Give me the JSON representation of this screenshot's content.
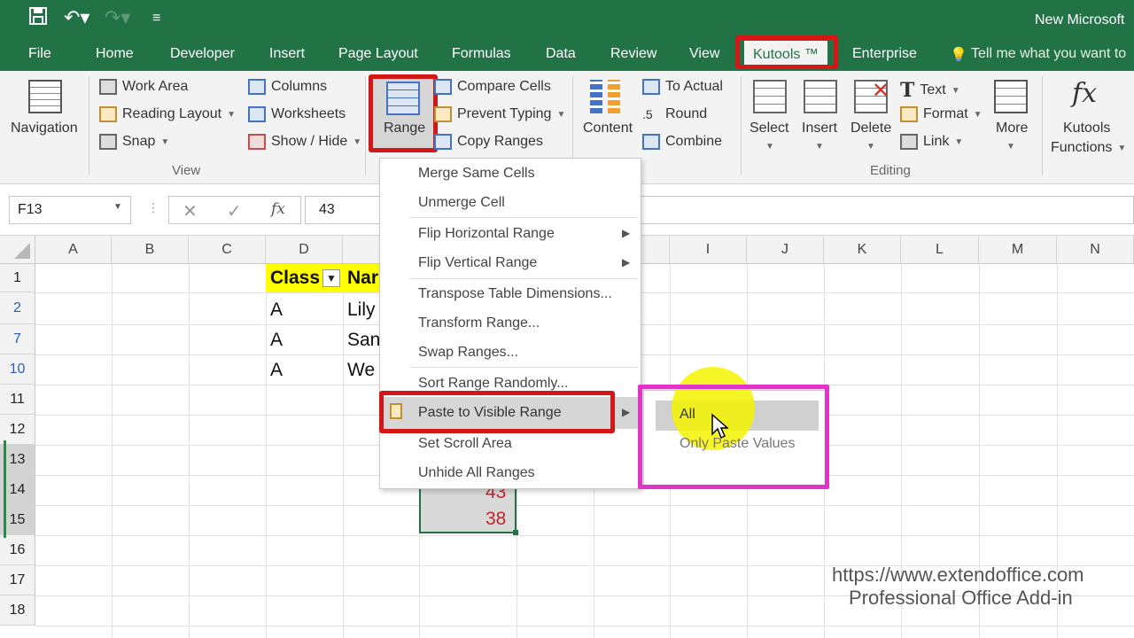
{
  "window": {
    "title": "New Microsoft"
  },
  "tabs": [
    "File",
    "Home",
    "Developer",
    "Insert",
    "Page Layout",
    "Formulas",
    "Data",
    "Review",
    "View",
    "Kutools ™",
    "Enterprise",
    "Tell me what you want to"
  ],
  "ribbon": {
    "navigation": "Navigation",
    "view_group": {
      "items": [
        "Work Area",
        "Reading Layout",
        "Snap",
        "Columns",
        "Worksheets",
        "Show / Hide"
      ],
      "label": "View"
    },
    "range": "Range",
    "range_items": [
      "Compare Cells",
      "Prevent Typing",
      "Copy Ranges"
    ],
    "content": "Content",
    "content_items": [
      "To Actual",
      "Round",
      "Combine"
    ],
    "editing": {
      "select": "Select",
      "insert": "Insert",
      "delete": "Delete",
      "text": "Text",
      "format": "Format",
      "link": "Link",
      "more": "More",
      "label": "Editing"
    },
    "kutools_functions": [
      "Kutools",
      "Functions"
    ]
  },
  "formula_bar": {
    "name_box": "F13",
    "value": "43",
    "fx": "fx"
  },
  "columns": [
    "A",
    "B",
    "C",
    "D",
    "",
    "",
    "",
    "",
    "I",
    "J",
    "K",
    "L",
    "M",
    "N"
  ],
  "rows": [
    "1",
    "2",
    "7",
    "10",
    "11",
    "12",
    "13",
    "14",
    "15",
    "16",
    "17",
    "18"
  ],
  "cells": {
    "d1": "Class",
    "e1": "Nar",
    "d2": "A",
    "e2": "Lily",
    "d7": "A",
    "e7": "San",
    "d10": "A",
    "e10": "We",
    "f14": "43",
    "f15": "38"
  },
  "menu": {
    "items": [
      "Merge Same Cells",
      "Unmerge Cell",
      "Flip Horizontal Range",
      "Flip Vertical Range",
      "Transpose Table Dimensions...",
      "Transform Range...",
      "Swap Ranges...",
      "Sort Range Randomly...",
      "Paste to Visible Range",
      "Set Scroll Area",
      "Unhide All Ranges"
    ]
  },
  "submenu": {
    "items": [
      "All",
      "Only Paste Values"
    ]
  },
  "watermark": {
    "line1": "https://www.extendoffice.com",
    "line2": "Professional Office Add-in"
  },
  "colors": {
    "excel_green": "#217346",
    "highlight_red": "#d41616",
    "highlight_magenta": "#e234c8",
    "cursor_highlight": "#f4f400"
  }
}
